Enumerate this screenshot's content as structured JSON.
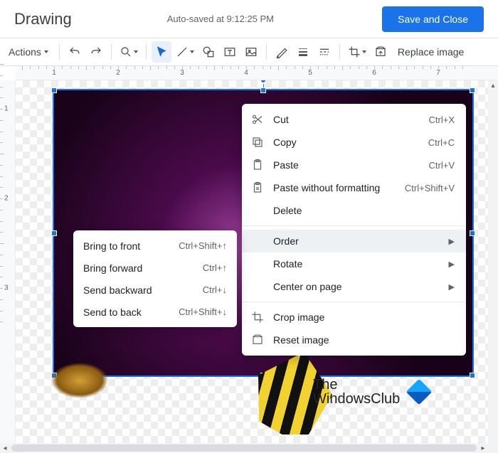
{
  "header": {
    "title": "Drawing",
    "autosave": "Auto-saved at 9:12:25 PM",
    "close_label": "Save and Close"
  },
  "toolbar": {
    "actions_label": "Actions",
    "replace_label": "Replace image"
  },
  "ruler": {
    "h_numbers": [
      "1",
      "2",
      "3",
      "4",
      "5",
      "6",
      "7"
    ],
    "v_numbers": [
      "1",
      "2",
      "3"
    ]
  },
  "watermark": {
    "line1": "The",
    "line2": "WindowsClub"
  },
  "context_menu": {
    "cut": {
      "label": "Cut",
      "shortcut": "Ctrl+X"
    },
    "copy": {
      "label": "Copy",
      "shortcut": "Ctrl+C"
    },
    "paste": {
      "label": "Paste",
      "shortcut": "Ctrl+V"
    },
    "paste_plain": {
      "label": "Paste without formatting",
      "shortcut": "Ctrl+Shift+V"
    },
    "delete": {
      "label": "Delete"
    },
    "order": {
      "label": "Order"
    },
    "rotate": {
      "label": "Rotate"
    },
    "center": {
      "label": "Center on page"
    },
    "crop": {
      "label": "Crop image"
    },
    "reset": {
      "label": "Reset image"
    }
  },
  "order_submenu": {
    "front": {
      "label": "Bring to front",
      "shortcut": "Ctrl+Shift+↑"
    },
    "forward": {
      "label": "Bring forward",
      "shortcut": "Ctrl+↑"
    },
    "backward": {
      "label": "Send backward",
      "shortcut": "Ctrl+↓"
    },
    "back": {
      "label": "Send to back",
      "shortcut": "Ctrl+Shift+↓"
    }
  }
}
